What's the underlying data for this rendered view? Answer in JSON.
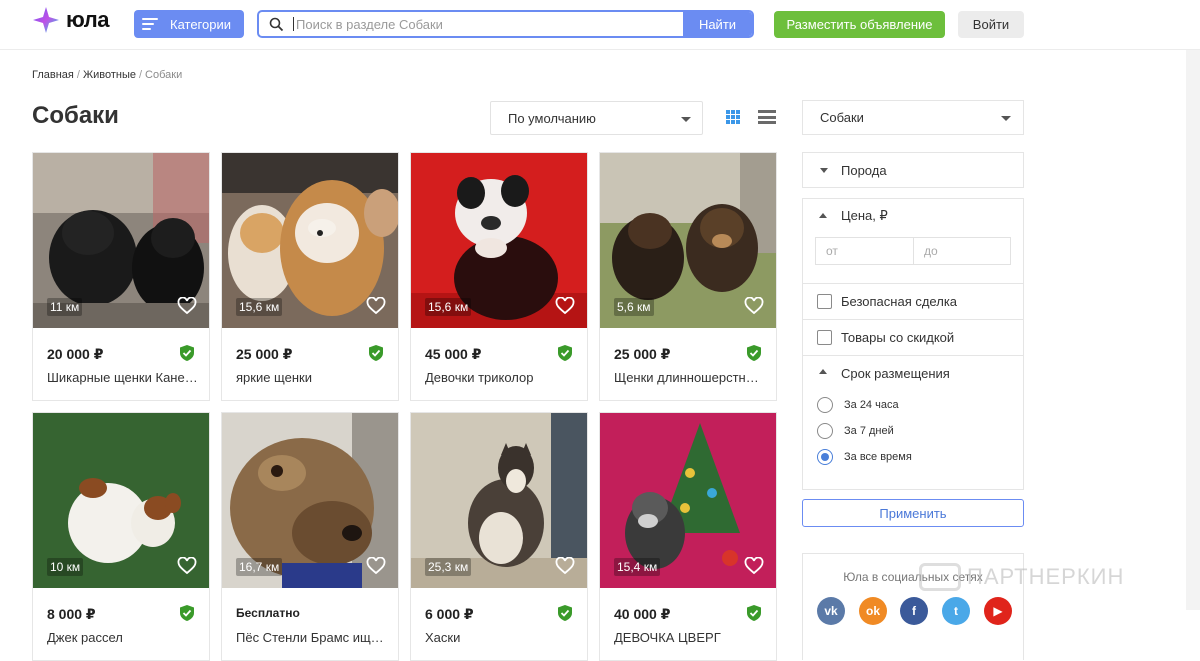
{
  "header": {
    "logo_text": "юла",
    "categories_label": "Категории",
    "search_placeholder": "Поиск в разделе Собаки",
    "search_button": "Найти",
    "post_button": "Разместить объявление",
    "login_button": "Войти"
  },
  "breadcrumbs": {
    "home": "Главная",
    "animals": "Животные",
    "current": "Собаки",
    "separator": "/"
  },
  "page_title": "Собаки",
  "sort": {
    "selected": "По умолчанию"
  },
  "view": {
    "active": "grid"
  },
  "listings": [
    {
      "distance": "11 км",
      "price": "20 000 ₽",
      "name": "Шикарные щенки Кане…",
      "verified": true
    },
    {
      "distance": "15,6 км",
      "price": "25 000 ₽",
      "name": "яркие щенки",
      "verified": true
    },
    {
      "distance": "15,6 км",
      "price": "45 000 ₽",
      "name": "Девочки триколор",
      "verified": true
    },
    {
      "distance": "5,6 км",
      "price": "25 000 ₽",
      "name": "Щенки длинношерстн…",
      "verified": true
    },
    {
      "distance": "10 км",
      "price": "8 000 ₽",
      "name": "Джек рассел",
      "verified": true
    },
    {
      "distance": "16,7 км",
      "price": "Бесплатно",
      "name": "Пёс Стенли Брамс ище…",
      "verified": false
    },
    {
      "distance": "25,3 км",
      "price": "6 000 ₽",
      "name": "Хаски",
      "verified": true
    },
    {
      "distance": "15,4 км",
      "price": "40 000 ₽",
      "name": "ДЕВОЧКА ЦВЕРГ",
      "verified": true
    }
  ],
  "sidebar": {
    "category": "Собаки",
    "breed_label": "Порода",
    "price_label": "Цена, ₽",
    "price_from_placeholder": "от",
    "price_to_placeholder": "до",
    "safe_deal_label": "Безопасная сделка",
    "discount_label": "Товары со скидкой",
    "period_label": "Срок размещения",
    "period_options": [
      {
        "label": "За 24 часа",
        "selected": false
      },
      {
        "label": "За 7 дней",
        "selected": false
      },
      {
        "label": "За все время",
        "selected": true
      }
    ],
    "apply_button": "Применить"
  },
  "social": {
    "title": "Юла в социальных сетях",
    "networks": [
      {
        "name": "vk-icon",
        "glyph": "vk",
        "color": "#5b7aa8"
      },
      {
        "name": "odnoklassniki-icon",
        "glyph": "ok",
        "color": "#f08a24"
      },
      {
        "name": "facebook-icon",
        "glyph": "f",
        "color": "#3b5a9a"
      },
      {
        "name": "twitter-icon",
        "glyph": "t",
        "color": "#4aa8e8"
      },
      {
        "name": "youtube-icon",
        "glyph": "▶",
        "color": "#e0241b"
      }
    ]
  },
  "watermark_text": "ПАРТНЕРКИН",
  "colors": {
    "accent": "#6b8cf2",
    "post_green": "#6dbf3c",
    "verified_green": "#3a9a2a",
    "radio_blue": "#4a7fd9"
  }
}
